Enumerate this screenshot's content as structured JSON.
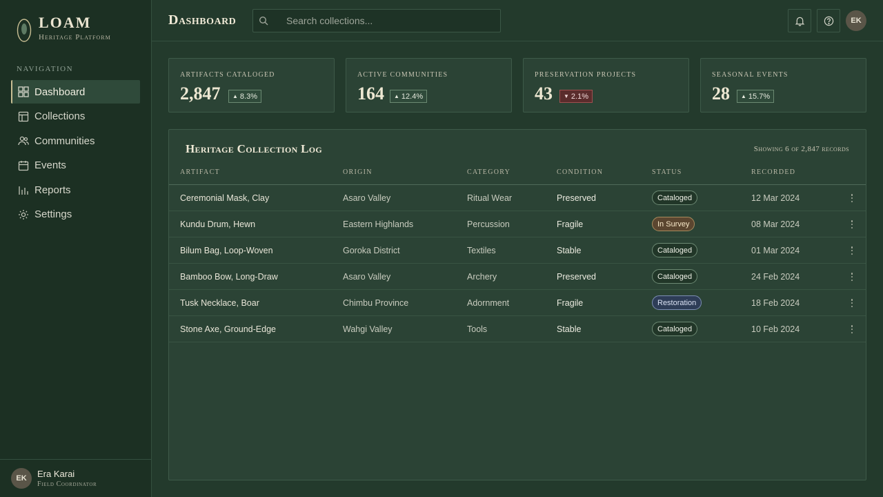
{
  "brand": {
    "name": "LOAM",
    "subtitle": "Heritage Platform"
  },
  "sidebar": {
    "heading": "Navigation",
    "items": [
      {
        "label": "Dashboard",
        "icon": "grid-icon",
        "active": true
      },
      {
        "label": "Collections",
        "icon": "layout-icon"
      },
      {
        "label": "Communities",
        "icon": "users-icon"
      },
      {
        "label": "Events",
        "icon": "calendar-icon"
      },
      {
        "label": "Reports",
        "icon": "bar-chart-icon"
      },
      {
        "label": "Settings",
        "icon": "gear-icon"
      }
    ],
    "user": {
      "initials": "EK",
      "name": "Era Karai",
      "role": "Field Coordinator"
    }
  },
  "header": {
    "title": "Dashboard",
    "search_placeholder": "Search collections...",
    "avatar_initials": "EK",
    "icons": [
      "bell-icon",
      "help-icon"
    ]
  },
  "stats": [
    {
      "label": "Artifacts Cataloged",
      "value": "2,847",
      "delta": "8.3%",
      "direction": "up"
    },
    {
      "label": "Active Communities",
      "value": "164",
      "delta": "12.4%",
      "direction": "up"
    },
    {
      "label": "Preservation Projects",
      "value": "43",
      "delta": "2.1%",
      "direction": "down"
    },
    {
      "label": "Seasonal Events",
      "value": "28",
      "delta": "15.7%",
      "direction": "up"
    }
  ],
  "table": {
    "title": "Heritage Collection Log",
    "count_text": "Showing 6 of 2,847 records",
    "columns": [
      "Artifact",
      "Origin",
      "Category",
      "Condition",
      "Status",
      "Recorded"
    ],
    "rows": [
      {
        "artifact": "Ceremonial Mask, Clay",
        "origin": "Asaro Valley",
        "category": "Ritual Wear",
        "condition": "Preserved",
        "status": "Cataloged",
        "status_type": "cataloged",
        "recorded": "12 Mar 2024"
      },
      {
        "artifact": "Kundu Drum, Hewn",
        "origin": "Eastern Highlands",
        "category": "Percussion",
        "condition": "Fragile",
        "status": "In Survey",
        "status_type": "survey",
        "recorded": "08 Mar 2024"
      },
      {
        "artifact": "Bilum Bag, Loop-Woven",
        "origin": "Goroka District",
        "category": "Textiles",
        "condition": "Stable",
        "status": "Cataloged",
        "status_type": "cataloged",
        "recorded": "01 Mar 2024"
      },
      {
        "artifact": "Bamboo Bow, Long-Draw",
        "origin": "Asaro Valley",
        "category": "Archery",
        "condition": "Preserved",
        "status": "Cataloged",
        "status_type": "cataloged",
        "recorded": "24 Feb 2024"
      },
      {
        "artifact": "Tusk Necklace, Boar",
        "origin": "Chimbu Province",
        "category": "Adornment",
        "condition": "Fragile",
        "status": "Restoration",
        "status_type": "resto",
        "recorded": "18 Feb 2024"
      },
      {
        "artifact": "Stone Axe, Ground-Edge",
        "origin": "Wahgi Valley",
        "category": "Tools",
        "condition": "Stable",
        "status": "Cataloged",
        "status_type": "cataloged",
        "recorded": "10 Feb 2024"
      }
    ]
  },
  "colors": {
    "background": "#233a2c",
    "sidebar": "#1c3023",
    "accent": "#c9bf94",
    "status_survey": "#5b4630",
    "status_restoration": "#2e3d57",
    "delta_down": "#5a2c2c"
  }
}
